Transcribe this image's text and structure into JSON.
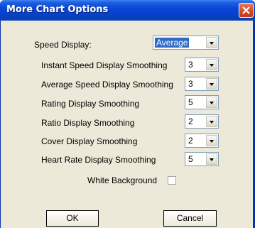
{
  "window": {
    "title": "More Chart Options"
  },
  "speed_display": {
    "label": "Speed Display:",
    "value": "Average"
  },
  "settings": [
    {
      "label": "Instant Speed Display Smoothing",
      "value": "3"
    },
    {
      "label": "Average Speed Display Smoothing",
      "value": "3"
    },
    {
      "label": "Rating Display Smoothing",
      "value": "5"
    },
    {
      "label": "Ratio Display Smoothing",
      "value": "2"
    },
    {
      "label": "Cover Display Smoothing",
      "value": "2"
    },
    {
      "label": "Heart Rate Display Smoothing",
      "value": "5"
    }
  ],
  "white_background": {
    "label": "White Background",
    "checked": false
  },
  "buttons": {
    "ok": "OK",
    "cancel": "Cancel"
  }
}
